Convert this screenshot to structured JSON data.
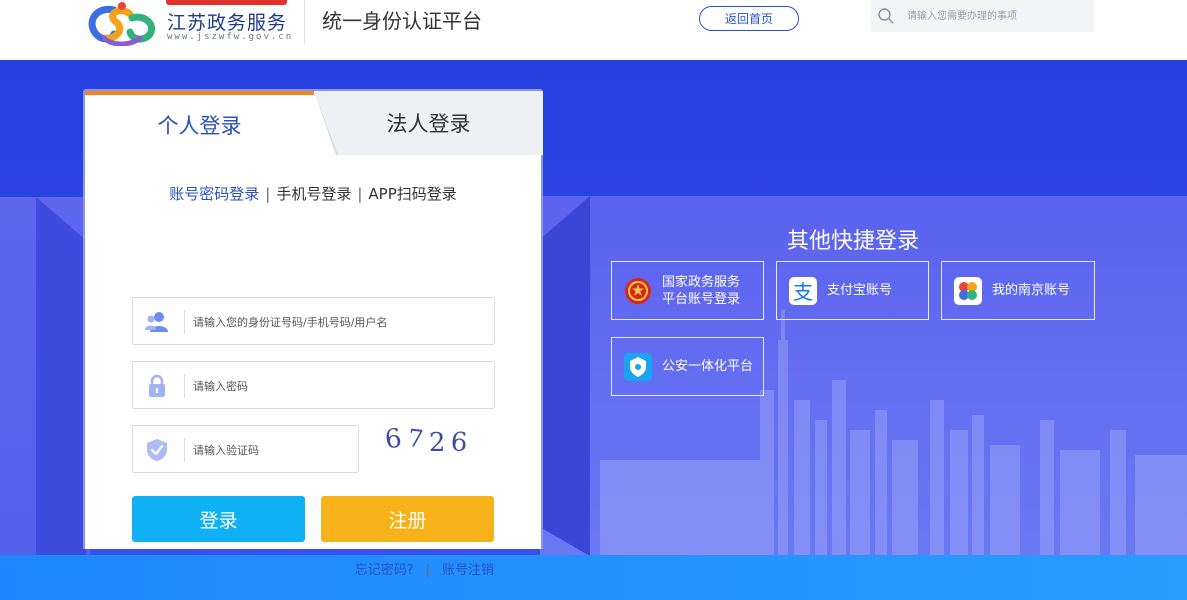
{
  "header": {
    "logo_text": "江苏政务服务",
    "logo_url_text": "www.jszwfw.gov.cn",
    "platform_title": "统一身份认证平台",
    "home_button": "返回首页",
    "search": {
      "placeholder": "请输入您需要办理的事项"
    }
  },
  "login": {
    "tabs": [
      {
        "label": "个人登录",
        "active": true
      },
      {
        "label": "法人登录",
        "active": false
      }
    ],
    "methods": [
      {
        "label": "账号密码登录",
        "active": true
      },
      {
        "label": "手机号登录",
        "active": false
      },
      {
        "label": "APP扫码登录",
        "active": false
      }
    ],
    "method_separator": "|",
    "fields": {
      "username": {
        "placeholder": "请输入您的身份证号码/手机号码/用户名",
        "icon": "user-icon"
      },
      "password": {
        "placeholder": "请输入密码",
        "icon": "lock-icon"
      },
      "captcha": {
        "placeholder": "请输入验证码",
        "icon": "shield-icon"
      }
    },
    "captcha_code": [
      "6",
      "7",
      "2",
      "6"
    ],
    "login_button": "登录",
    "register_button": "注册",
    "forgot_password": "忘记密码?",
    "link_separator": "|",
    "cancel_account": "账号注销"
  },
  "quick_login": {
    "title": "其他快捷登录",
    "items": [
      {
        "label": "国家政务服务\n平台账号登录",
        "icon": "national-emblem-icon"
      },
      {
        "label": "支付宝账号",
        "icon": "alipay-icon"
      },
      {
        "label": "我的南京账号",
        "icon": "my-nanjing-icon"
      },
      {
        "label": "公安一体化平台",
        "icon": "police-badge-icon"
      }
    ]
  },
  "colors": {
    "brand_blue": "#2a51b9",
    "banner_blue": "#2641e0",
    "login_button": "#0fb0f4",
    "register_button": "#f7b21a",
    "active_tab_accent": "#f5821f"
  }
}
